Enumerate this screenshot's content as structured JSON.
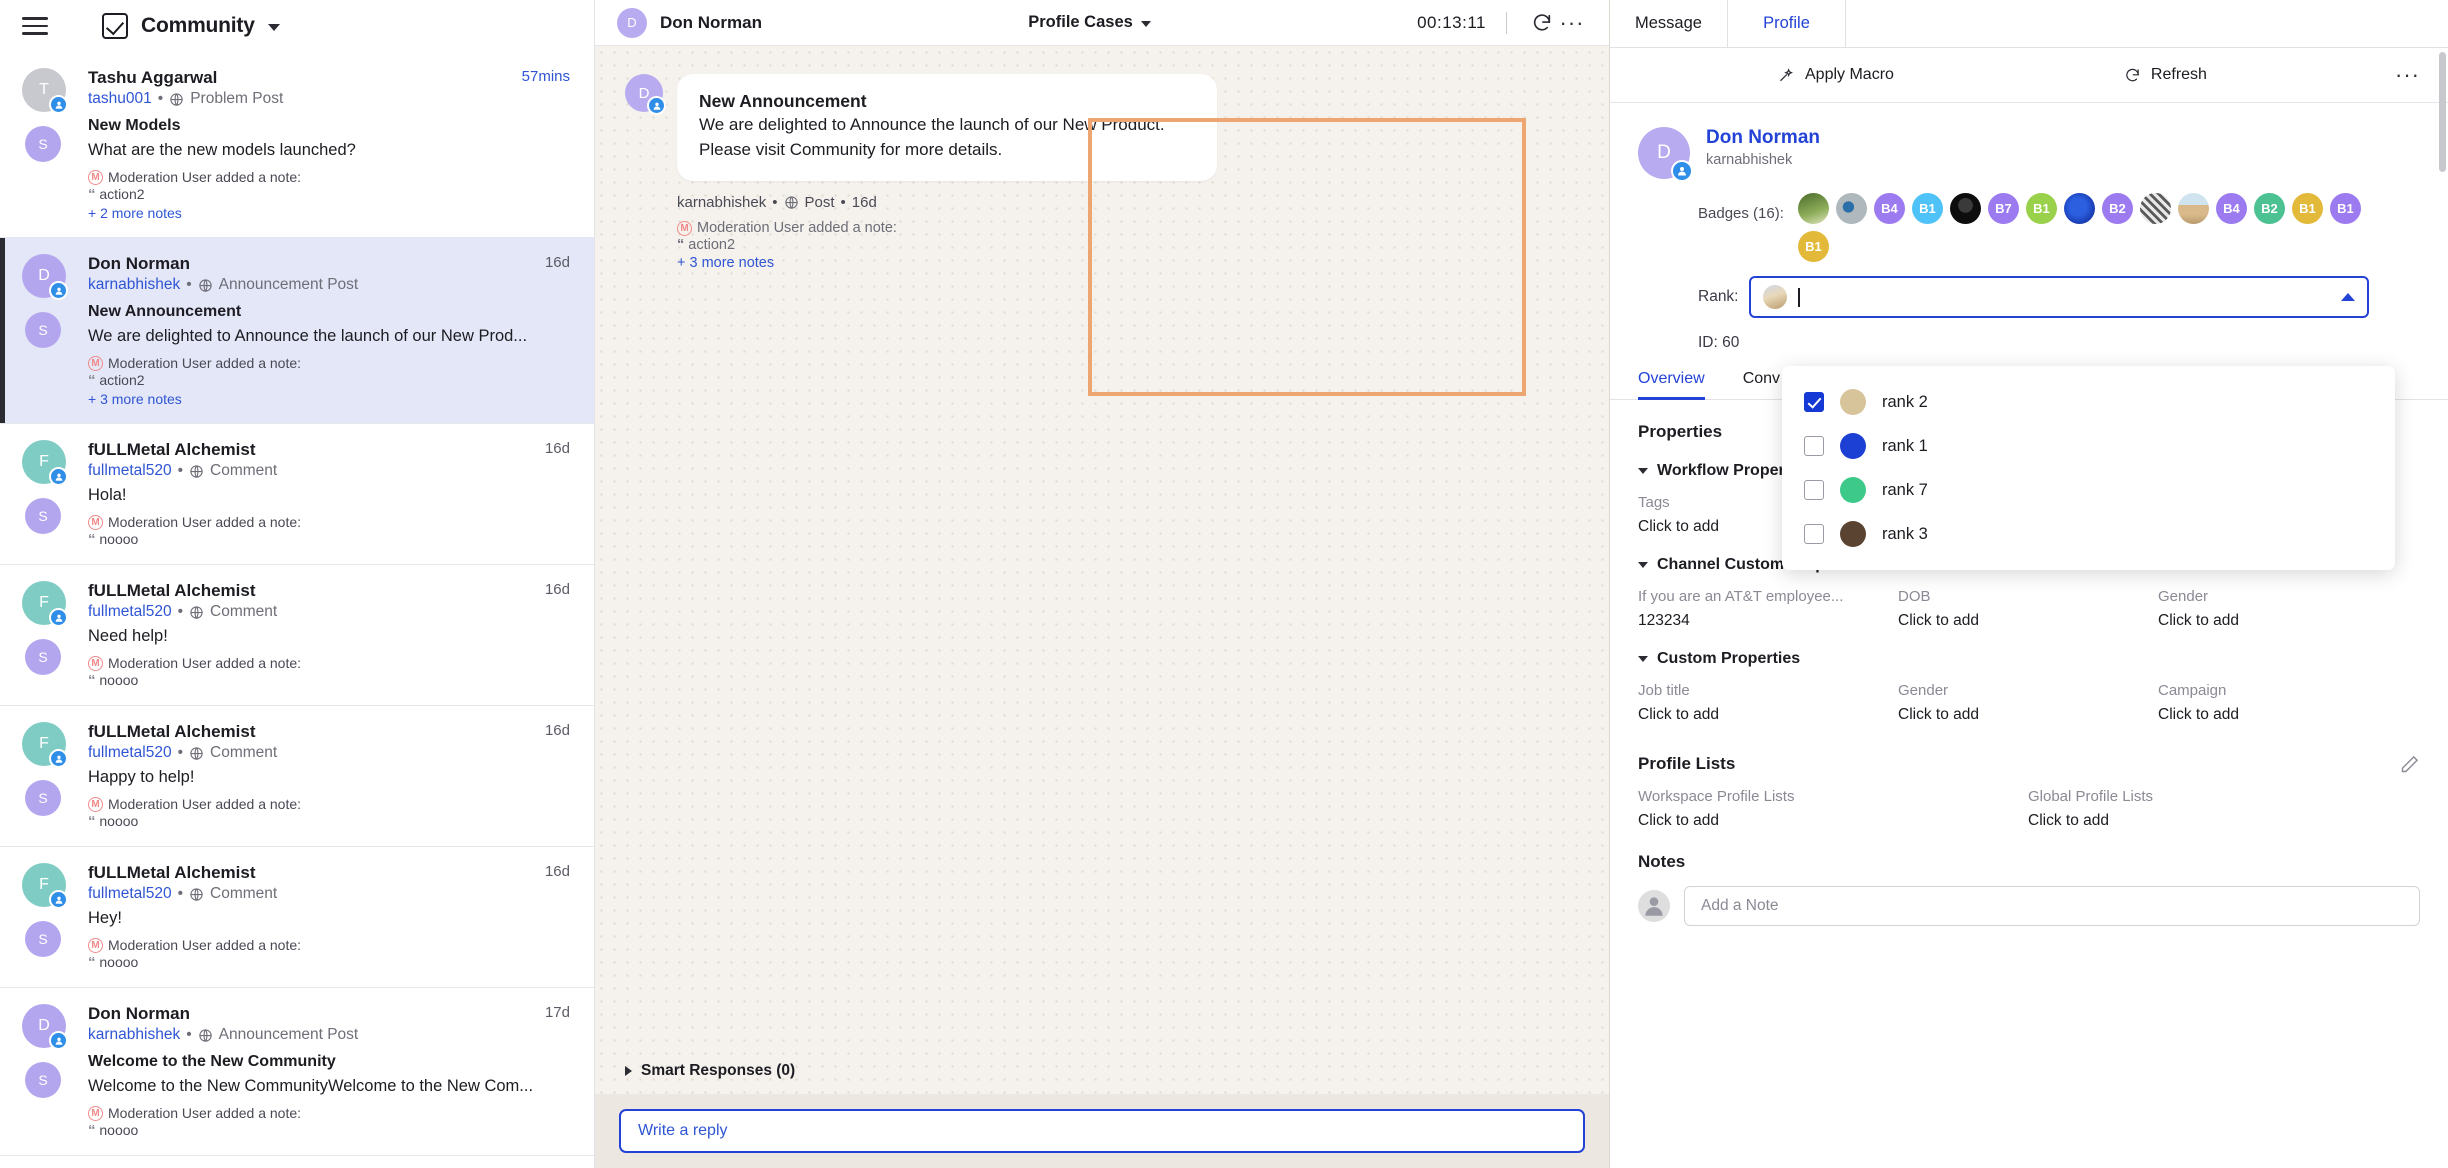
{
  "sidebar": {
    "title": "Community",
    "conversations": [
      {
        "name": "Tashu Aggarwal",
        "handle": "tashu001",
        "type": "Problem Post",
        "time": "57mins",
        "time_style": "blue",
        "subject": "New Models",
        "snippet": "What are the new models launched?",
        "note": "Moderation User added a note:",
        "quote": "action2",
        "more": "+ 2 more notes",
        "initial": "T",
        "color": "#c8c8cf",
        "selected": false
      },
      {
        "name": "Don Norman",
        "handle": "karnabhishek",
        "type": "Announcement Post",
        "time": "16d",
        "time_style": "plain",
        "subject": "New Announcement",
        "snippet": "We are delighted to Announce the launch of our New Prod...",
        "note": "Moderation User added a note:",
        "quote": "action2",
        "more": "+ 3 more notes",
        "initial": "D",
        "color": "#b3a6ef",
        "selected": true
      },
      {
        "name": "fULLMetal Alchemist",
        "handle": "fullmetal520",
        "type": "Comment",
        "time": "16d",
        "time_style": "plain",
        "subject": "",
        "snippet": "Hola!",
        "note": "Moderation User added a note:",
        "quote": "noooo",
        "more": "",
        "initial": "F",
        "color": "#7fccc4",
        "selected": false
      },
      {
        "name": "fULLMetal Alchemist",
        "handle": "fullmetal520",
        "type": "Comment",
        "time": "16d",
        "time_style": "plain",
        "subject": "",
        "snippet": "Need help!",
        "note": "Moderation User added a note:",
        "quote": "noooo",
        "more": "",
        "initial": "F",
        "color": "#7fccc4",
        "selected": false
      },
      {
        "name": "fULLMetal Alchemist",
        "handle": "fullmetal520",
        "type": "Comment",
        "time": "16d",
        "time_style": "plain",
        "subject": "",
        "snippet": "Happy to help!",
        "note": "Moderation User added a note:",
        "quote": "noooo",
        "more": "",
        "initial": "F",
        "color": "#7fccc4",
        "selected": false
      },
      {
        "name": "fULLMetal Alchemist",
        "handle": "fullmetal520",
        "type": "Comment",
        "time": "16d",
        "time_style": "plain",
        "subject": "",
        "snippet": "Hey!",
        "note": "Moderation User added a note:",
        "quote": "noooo",
        "more": "",
        "initial": "F",
        "color": "#7fccc4",
        "selected": false
      },
      {
        "name": "Don Norman",
        "handle": "karnabhishek",
        "type": "Announcement Post",
        "time": "17d",
        "time_style": "plain",
        "subject": "Welcome to the New Community",
        "snippet": "Welcome to the New CommunityWelcome to the New Com...",
        "note": "Moderation User added a note:",
        "quote": "noooo",
        "more": "",
        "initial": "D",
        "color": "#b3a6ef",
        "selected": false
      }
    ]
  },
  "center": {
    "header": {
      "avatar_initial": "D",
      "name": "Don Norman",
      "title": "Profile Cases",
      "timer": "00:13:11"
    },
    "message": {
      "avatar_initial": "D",
      "title": "New Announcement",
      "body": "We are delighted to Announce the launch of our New Product. Please visit Community for more details.",
      "meta_handle": "karnabhishek",
      "meta_type": "Post",
      "meta_time": "16d",
      "note": "Moderation User added a note:",
      "quote": "action2",
      "more_notes": "+ 3 more notes"
    },
    "smart_responses": "Smart Responses (0)",
    "reply_placeholder": "Write a reply"
  },
  "right": {
    "tabs": [
      {
        "label": "Message",
        "active": false
      },
      {
        "label": "Profile",
        "active": true
      }
    ],
    "toolbar": {
      "apply_macro": "Apply Macro",
      "refresh": "Refresh"
    },
    "profile": {
      "avatar_initial": "D",
      "name": "Don Norman",
      "handle": "karnabhishek"
    },
    "badges_label": "Badges (16):",
    "badges": [
      {
        "text": "",
        "color": "#5e7246",
        "kind": "photo-garden"
      },
      {
        "text": "",
        "color": "#9aa3a8",
        "kind": "photo-eye"
      },
      {
        "text": "B4",
        "color": "#9b7bef",
        "kind": "text"
      },
      {
        "text": "B1",
        "color": "#4fc3f7",
        "kind": "text"
      },
      {
        "text": "",
        "color": "#1a1a1a",
        "kind": "photo-dark"
      },
      {
        "text": "B7",
        "color": "#9b7bef",
        "kind": "text"
      },
      {
        "text": "B1",
        "color": "#9ad14b",
        "kind": "text"
      },
      {
        "text": "",
        "color": "#1c3fd4",
        "kind": "photo-blue-rose"
      },
      {
        "text": "B2",
        "color": "#9b7bef",
        "kind": "text"
      },
      {
        "text": "",
        "color": "#8a8a8a",
        "kind": "photo-gray"
      },
      {
        "text": "",
        "color": "#cdbba6",
        "kind": "photo-beach"
      },
      {
        "text": "B4",
        "color": "#9b7bef",
        "kind": "text"
      },
      {
        "text": "B2",
        "color": "#4cc192",
        "kind": "text"
      },
      {
        "text": "B1",
        "color": "#e3b93a",
        "kind": "text"
      },
      {
        "text": "B1",
        "color": "#9b7bef",
        "kind": "text"
      },
      {
        "text": "B1",
        "color": "#e3b93a",
        "kind": "text"
      }
    ],
    "rank": {
      "label": "Rank:",
      "value": ""
    },
    "rank_options": [
      {
        "label": "rank 2",
        "checked": true,
        "color": "#d8c49a"
      },
      {
        "label": "rank 1",
        "checked": false,
        "color": "#1c3fd4"
      },
      {
        "label": "rank 7",
        "checked": false,
        "color": "#3cc98a"
      },
      {
        "label": "rank 3",
        "checked": false,
        "color": "#5a4330"
      }
    ],
    "id_row": "ID: 60",
    "overview_tabs": [
      {
        "label": "Overview",
        "active": true
      },
      {
        "label": "Conv",
        "active": false
      }
    ],
    "properties_heading": "Properties",
    "workflow_properties": {
      "heading": "Workflow Properties",
      "fields": [
        {
          "label": "Tags",
          "value": "Click to add"
        }
      ]
    },
    "channel_custom_properties": {
      "heading": "Channel Custom Properties",
      "fields": [
        {
          "label": "If you are an AT&T employee...",
          "value": "123234"
        },
        {
          "label": "DOB",
          "value": "Click to add"
        },
        {
          "label": "Gender",
          "value": "Click to add"
        }
      ]
    },
    "custom_properties": {
      "heading": "Custom Properties",
      "fields": [
        {
          "label": "Job title",
          "value": "Click to add"
        },
        {
          "label": "Gender",
          "value": "Click to add"
        },
        {
          "label": "Campaign",
          "value": "Click to add"
        }
      ]
    },
    "profile_lists": {
      "heading": "Profile Lists",
      "fields": [
        {
          "label": "Workspace Profile Lists",
          "value": "Click to add"
        },
        {
          "label": "Global Profile Lists",
          "value": "Click to add"
        }
      ]
    },
    "notes": {
      "heading": "Notes",
      "placeholder": "Add a Note"
    }
  },
  "colors": {
    "accent": "#2342d6",
    "highlight": "#eda571",
    "selected_row": "#e4e7f8"
  }
}
